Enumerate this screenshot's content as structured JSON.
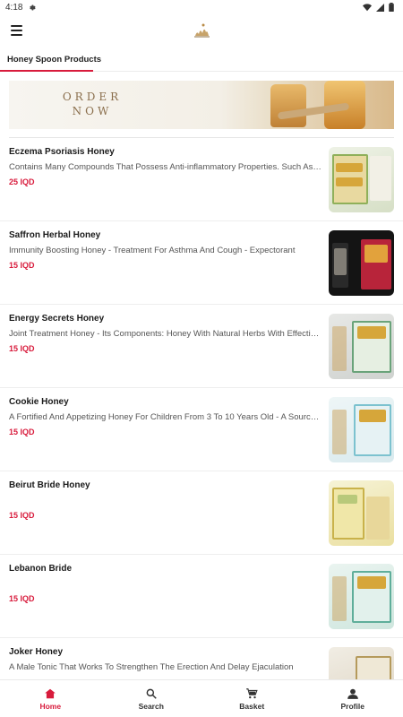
{
  "status_bar": {
    "time": "4:18"
  },
  "tabs": [
    {
      "label": "Honey Spoon Products",
      "active": true
    }
  ],
  "banner": {
    "line1": "ORDER",
    "line2": "NOW"
  },
  "products": [
    {
      "name": "Eczema Psoriasis Honey",
      "description": "Contains Many Compounds That Possess Anti-inflammatory Properties. Such As Flavonoids And Phenolic Acids",
      "price": "25 IQD"
    },
    {
      "name": "Saffron Herbal Honey",
      "description": "Immunity Boosting Honey - Treatment For Asthma And Cough - Expectorant",
      "price": "15 IQD"
    },
    {
      "name": "Energy Secrets Honey",
      "description": "Joint Treatment Honey - Its Components: Honey With Natural Herbs With Effective Properties",
      "price": "15 IQD"
    },
    {
      "name": "Cookie Honey",
      "description": "A Fortified And Appetizing Honey For Children From 3 To 10 Years Old - A Source Of Energy",
      "price": "15 IQD"
    },
    {
      "name": "Beirut Bride Honey",
      "description": "",
      "price": "15 IQD"
    },
    {
      "name": "Lebanon Bride",
      "description": "",
      "price": "15 IQD"
    },
    {
      "name": "Joker Honey",
      "description": "A Male Tonic That Works To Strengthen The Erection And Delay Ejaculation",
      "price": ""
    }
  ],
  "bottom_nav": [
    {
      "label": "Home",
      "icon": "home-icon",
      "active": true
    },
    {
      "label": "Search",
      "icon": "search-icon",
      "active": false
    },
    {
      "label": "Basket",
      "icon": "basket-icon",
      "active": false
    },
    {
      "label": "Profile",
      "icon": "profile-icon",
      "active": false
    }
  ],
  "colors": {
    "accent": "#d81b3c"
  }
}
